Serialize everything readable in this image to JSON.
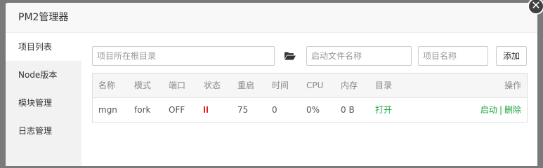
{
  "dialog": {
    "title": "PM2管理器",
    "close_glyph": "✕"
  },
  "sidebar": {
    "items": [
      {
        "label": "项目列表",
        "active": true
      },
      {
        "label": "Node版本",
        "active": false
      },
      {
        "label": "模块管理",
        "active": false
      },
      {
        "label": "日志管理",
        "active": false
      }
    ]
  },
  "form": {
    "root_dir_placeholder": "项目所在根目录",
    "root_dir_value": "",
    "start_file_placeholder": "启动文件名称",
    "start_file_value": "",
    "project_name_placeholder": "项目名称",
    "project_name_value": "",
    "add_label": "添加"
  },
  "table": {
    "headers": [
      "名称",
      "模式",
      "端口",
      "状态",
      "重启",
      "时间",
      "CPU",
      "内存",
      "目录",
      "操作"
    ],
    "rows": [
      {
        "name": "mgn",
        "mode": "fork",
        "port": "OFF",
        "status_icon": "pause-icon",
        "restarts": "75",
        "time": "0",
        "cpu": "0%",
        "memory": "0 B",
        "directory": "打开",
        "action_start": "启动",
        "action_sep": "|",
        "action_delete": "删除"
      }
    ]
  },
  "colors": {
    "accent_green": "#20a53a",
    "status_red": "#e02020"
  }
}
